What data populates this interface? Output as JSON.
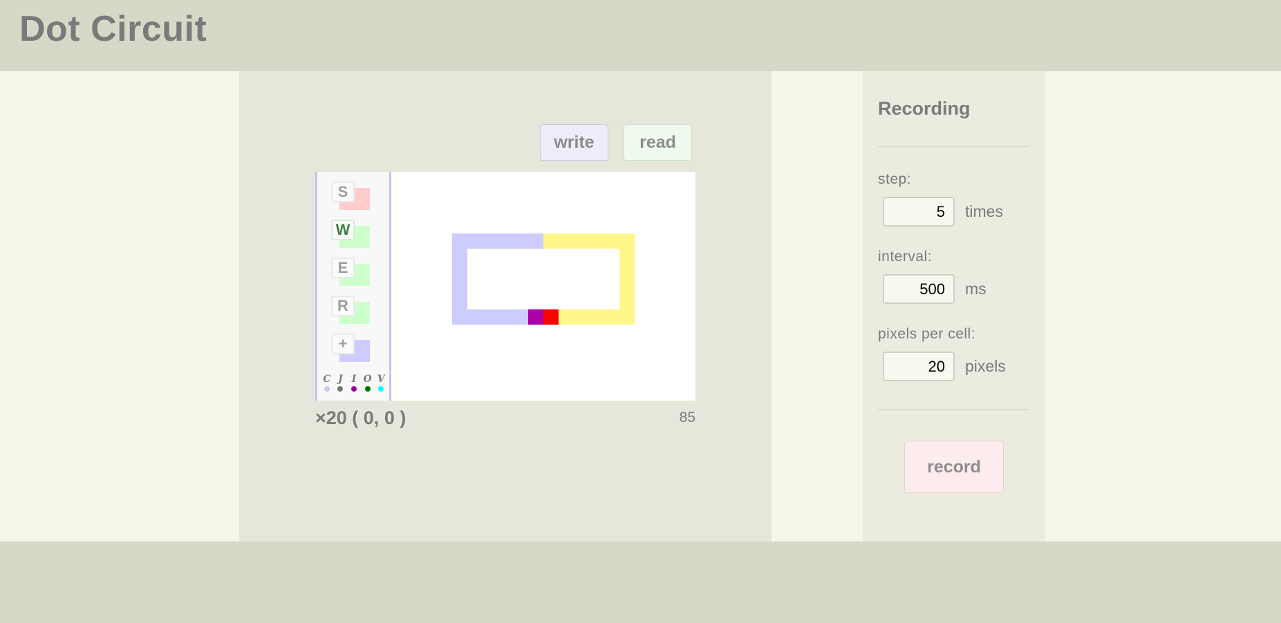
{
  "app": {
    "title": "Dot Circuit"
  },
  "toolbar": {
    "write_label": "write",
    "read_label": "read"
  },
  "tools": [
    {
      "key": "S",
      "swatch_color": "#ffcccc",
      "active": false
    },
    {
      "key": "W",
      "swatch_color": "#ccffcc",
      "active": true
    },
    {
      "key": "E",
      "swatch_color": "#ccffcc",
      "active": false
    },
    {
      "key": "R",
      "swatch_color": "#ccffcc",
      "active": false
    },
    {
      "key": "+",
      "swatch_color": "#ccccff",
      "active": false
    }
  ],
  "legend": [
    {
      "letter": "C",
      "color": "#c8c8f0"
    },
    {
      "letter": "J",
      "color": "#777777"
    },
    {
      "letter": "I",
      "color": "#990099"
    },
    {
      "letter": "O",
      "color": "#007700"
    },
    {
      "letter": "V",
      "color": "#00ffff"
    }
  ],
  "colors": {
    "wire_idle": "#ccccff",
    "wire_active": "#fff78a",
    "node_purple": "#aa00aa",
    "node_red": "#ff0000"
  },
  "status": {
    "zoom": "×20 ( 0, 0 )",
    "count": "85"
  },
  "recording": {
    "title": "Recording",
    "step_label": "step:",
    "step_value": "5",
    "step_unit": "times",
    "interval_label": "interval:",
    "interval_value": "500",
    "interval_unit": "ms",
    "ppc_label": "pixels per cell:",
    "ppc_value": "20",
    "ppc_unit": "pixels",
    "record_label": "record"
  }
}
